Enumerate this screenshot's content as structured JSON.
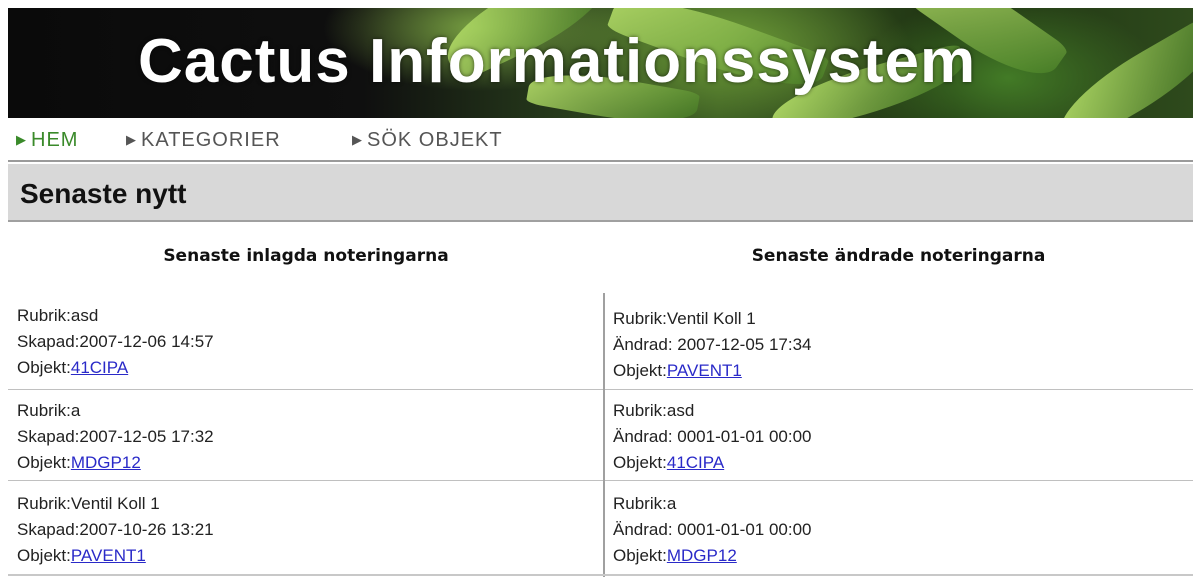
{
  "banner": {
    "title": "Cactus Informationssystem"
  },
  "nav": {
    "items": [
      {
        "label": "HEM",
        "active": true
      },
      {
        "label": "KATEGORIER",
        "active": false
      },
      {
        "label": "SÖK OBJEKT",
        "active": false
      }
    ]
  },
  "section": {
    "title": "Senaste nytt"
  },
  "columns": {
    "left_header": "Senaste inlagda noteringarna",
    "right_header": "Senaste ändrade noteringarna"
  },
  "labels": {
    "rubrik": "Rubrik:",
    "skapad": "Skapad:",
    "andrad": "Ändrad: ",
    "objekt": "Objekt:"
  },
  "latest_added": [
    {
      "rubrik": "asd",
      "skapad": "2007-12-06 14:57",
      "objekt": "41CIPA"
    },
    {
      "rubrik": "a",
      "skapad": "2007-12-05 17:32",
      "objekt": "MDGP12"
    },
    {
      "rubrik": "Ventil Koll 1",
      "skapad": "2007-10-26 13:21",
      "objekt": "PAVENT1"
    }
  ],
  "latest_changed": [
    {
      "rubrik": "Ventil Koll 1",
      "andrad": "2007-12-05 17:34",
      "objekt": "PAVENT1"
    },
    {
      "rubrik": "asd",
      "andrad": "0001-01-01 00:00",
      "objekt": "41CIPA"
    },
    {
      "rubrik": "a",
      "andrad": "0001-01-01 00:00",
      "objekt": "MDGP12"
    }
  ],
  "colors": {
    "nav_active": "#3a8a2a",
    "link": "#2a2ac8",
    "section_bar": "#d8d8d8"
  }
}
